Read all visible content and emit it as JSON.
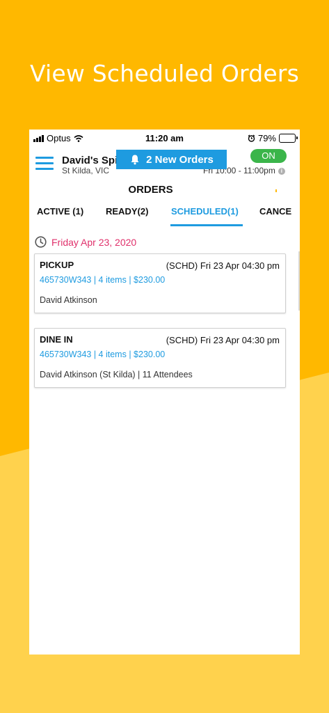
{
  "promo": {
    "title": "View Scheduled Orders"
  },
  "status_bar": {
    "carrier": "Optus",
    "time": "11:20 am",
    "battery": "79%",
    "battery_level": 0.79
  },
  "header": {
    "restaurant_name": "David's Spi",
    "location": "St Kilda, VIC",
    "new_orders_label": "2 New Orders",
    "toggle_label": "ON",
    "hours": "Fri 10:00 - 11:00pm"
  },
  "page_title": "ORDERS",
  "tabs": [
    {
      "label": "ACTIVE (1)"
    },
    {
      "label": "READY(2)"
    },
    {
      "label": "SCHEDULED(1)"
    },
    {
      "label": "CANCE"
    }
  ],
  "active_tab": "SCHEDULED(1)",
  "date_heading": "Friday Apr 23, 2020",
  "orders": [
    {
      "type": "PICKUP",
      "schedule": "(SCHD) Fri 23 Apr 04:30 pm",
      "summary": "465730W343 | 4 items | $230.00",
      "customer": "David Atkinson"
    },
    {
      "type": "DINE IN",
      "schedule": "(SCHD) Fri 23 Apr 04:30 pm",
      "summary": "465730W343 | 4 items | $230.00",
      "customer": "David Atkinson (St Kilda) | 11 Attendees"
    }
  ],
  "colors": {
    "brand_yellow": "#FFB800",
    "accent_blue": "#1E9BE0",
    "date_pink": "#E0306B",
    "toggle_green": "#3BB54A"
  }
}
